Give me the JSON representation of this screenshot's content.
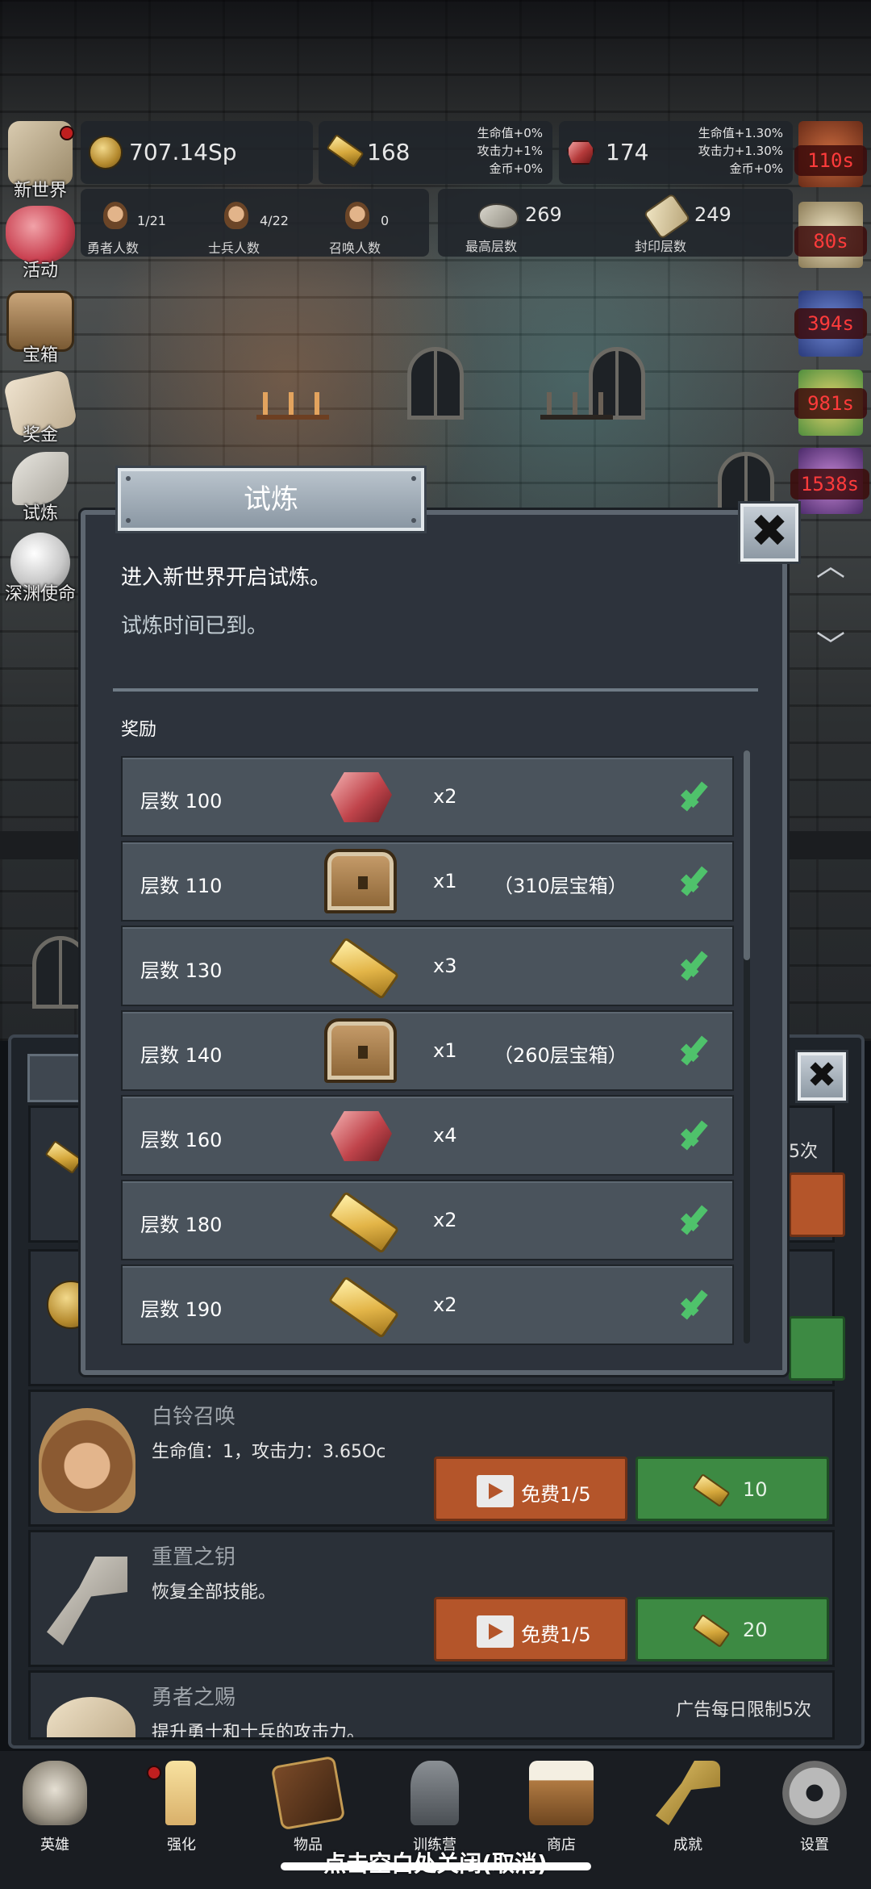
{
  "resources": {
    "coins": "707.14Sp",
    "gold_bars": "168",
    "gold_bonus": [
      "生命值+0%",
      "攻击力+1%",
      "金币+0%"
    ],
    "gems": "174",
    "gem_bonus": [
      "生命值+1.30%",
      "攻击力+1.30%",
      "金币+0%"
    ]
  },
  "stats": {
    "hero_count": "1/21",
    "hero_label": "勇者人数",
    "soldier_count": "4/22",
    "soldier_label": "士兵人数",
    "summon_count": "0",
    "summon_label": "召唤人数",
    "max_floor": "269",
    "max_floor_label": "最高层数",
    "seal_floor": "249",
    "seal_floor_label": "封印层数"
  },
  "left_menu": [
    {
      "label": "新世界",
      "icon": "map-icon"
    },
    {
      "label": "活动",
      "icon": "heart-icon"
    },
    {
      "label": "宝箱",
      "icon": "chest-icon"
    },
    {
      "label": "奖金",
      "icon": "letter-icon"
    },
    {
      "label": "试炼",
      "icon": "feather-icon"
    },
    {
      "label": "深渊使命",
      "icon": "orb-icon"
    }
  ],
  "buff_timers": [
    "110s",
    "80s",
    "394s",
    "981s",
    "1538s"
  ],
  "modal": {
    "title": "试炼",
    "line1": "进入新世界开启试炼。",
    "line2": "试炼时间已到。",
    "reward_label": "奖励",
    "rewards": [
      {
        "floor": "层数 100",
        "item": "gem",
        "qty": "x2",
        "note": ""
      },
      {
        "floor": "层数 110",
        "item": "chest",
        "qty": "x1",
        "note": "（310层宝箱）"
      },
      {
        "floor": "层数 130",
        "item": "gold",
        "qty": "x3",
        "note": ""
      },
      {
        "floor": "层数 140",
        "item": "chest",
        "qty": "x1",
        "note": "（260层宝箱）"
      },
      {
        "floor": "层数 160",
        "item": "gem",
        "qty": "x4",
        "note": ""
      },
      {
        "floor": "层数 180",
        "item": "gold",
        "qty": "x2",
        "note": ""
      },
      {
        "floor": "层数 190",
        "item": "gold",
        "qty": "x2",
        "note": ""
      }
    ]
  },
  "shop": {
    "partial_limit_1": "5次",
    "items": [
      {
        "title": "白铃召唤",
        "desc": "生命值：1，攻击力：3.65Oc",
        "free": "免费1/5",
        "cost": "10"
      },
      {
        "title": "重置之钥",
        "desc": "恢复全部技能。",
        "free": "免费1/5",
        "cost": "20"
      },
      {
        "title": "勇者之赐",
        "desc": "提升勇士和士兵的攻击力。",
        "limit": "广告每日限制5次"
      }
    ]
  },
  "bottom_nav": [
    {
      "label": "英雄",
      "icon": "skull-icon"
    },
    {
      "label": "强化",
      "icon": "candle-icon"
    },
    {
      "label": "物品",
      "icon": "book-icon"
    },
    {
      "label": "训练营",
      "icon": "lantern-icon"
    },
    {
      "label": "商店",
      "icon": "beer-mug-icon"
    },
    {
      "label": "成就",
      "icon": "key-icon"
    },
    {
      "label": "设置",
      "icon": "gear-icon"
    }
  ],
  "close_hint": "点击空白处关闭(取消)"
}
